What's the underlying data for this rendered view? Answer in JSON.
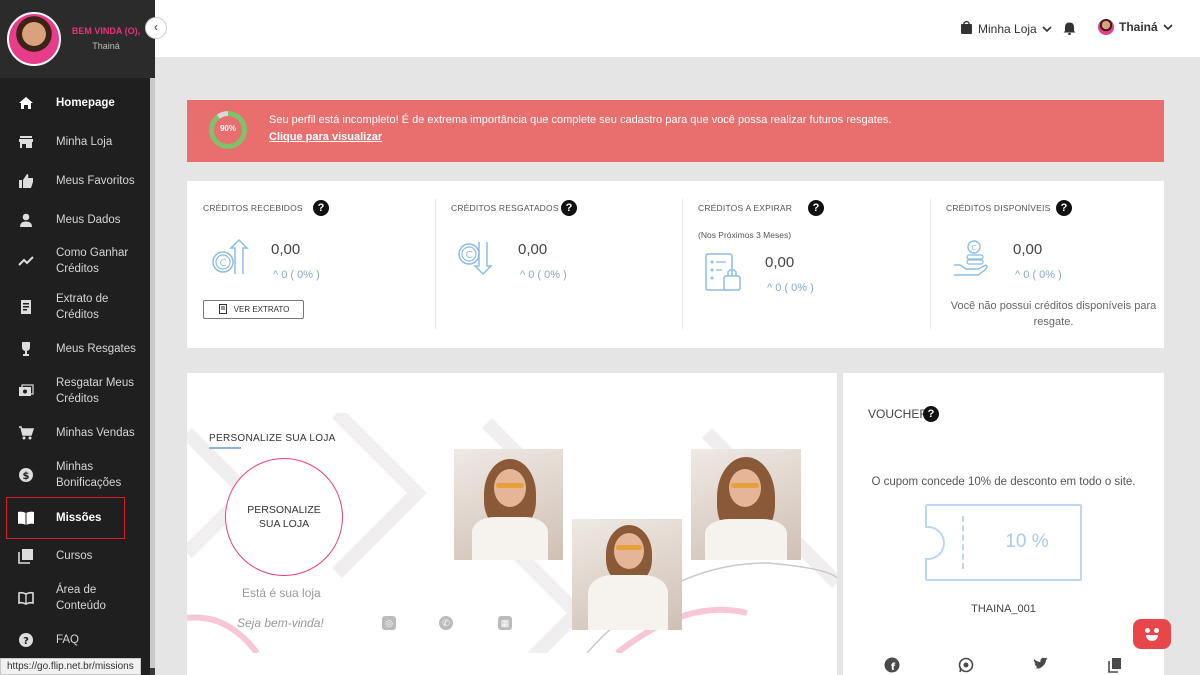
{
  "sidebar": {
    "welcome": "BEM VINDA (O),",
    "user_name": "Thainá",
    "items": [
      {
        "label": "Homepage",
        "icon": "home-icon"
      },
      {
        "label": "Minha Loja",
        "icon": "store-icon"
      },
      {
        "label": "Meus Favoritos",
        "icon": "thumbs-up-icon"
      },
      {
        "label": "Meus Dados",
        "icon": "person-icon"
      },
      {
        "label": "Como Ganhar Créditos",
        "icon": "trending-up-icon"
      },
      {
        "label": "Extrato de Créditos",
        "icon": "receipt-icon"
      },
      {
        "label": "Meus Resgates",
        "icon": "trophy-icon"
      },
      {
        "label": "Resgatar Meus Créditos",
        "icon": "redeem-icon"
      },
      {
        "label": "Minhas Vendas",
        "icon": "cart-icon"
      },
      {
        "label": "Minhas Bonificações",
        "icon": "dollar-icon"
      },
      {
        "label": "Missões",
        "icon": "book-icon"
      },
      {
        "label": "Cursos",
        "icon": "library-icon"
      },
      {
        "label": "Área de Conteúdo",
        "icon": "open-book-icon"
      },
      {
        "label": "FAQ",
        "icon": "help-icon"
      }
    ]
  },
  "header": {
    "store_menu": "Minha Loja",
    "user_menu": "Thainá"
  },
  "alert": {
    "progress": "90%",
    "message": "Seu perfil está incompleto! É de extrema importância que complete seu cadastro para que você possa realizar futuros resgates.",
    "link": "Clique para visualizar"
  },
  "credits": {
    "received": {
      "title": "CRÉDITOS RECEBIDOS",
      "value": "0,00",
      "delta": "0 ( 0% )",
      "button": "VER EXTRATO"
    },
    "redeemed": {
      "title": "CRÉDITOS RESGATADOS",
      "value": "0,00",
      "delta": "0 ( 0% )"
    },
    "expiring": {
      "title": "CRÉDITOS A EXPIRAR",
      "subtitle": "(Nos Próximos 3 Meses)",
      "value": "0,00",
      "delta": "0 ( 0% )"
    },
    "available": {
      "title": "CRÉDITOS DISPONÍVEIS",
      "value": "0,00",
      "delta": "0 ( 0% )",
      "note": "Você não possui créditos disponíveis para resgate."
    }
  },
  "store": {
    "title": "PERSONALIZE SUA LOJA",
    "circle_label": "PERSONALIZE SUA LOJA",
    "line1": "Está é sua loja",
    "line2": "Seja bem-vinda!"
  },
  "voucher": {
    "title": "VOUCHER",
    "description": "O cupom concede 10% de desconto em todo o site.",
    "value": "10 %",
    "code": "THAINA_001"
  },
  "statusbar": {
    "url": "https://go.flip.net.br/missions"
  },
  "colors": {
    "sidebar": "#1f1f1f",
    "alert": "#e96e6e",
    "brand_pink": "#e9317b",
    "voucher_border": "#bcd7ef"
  }
}
